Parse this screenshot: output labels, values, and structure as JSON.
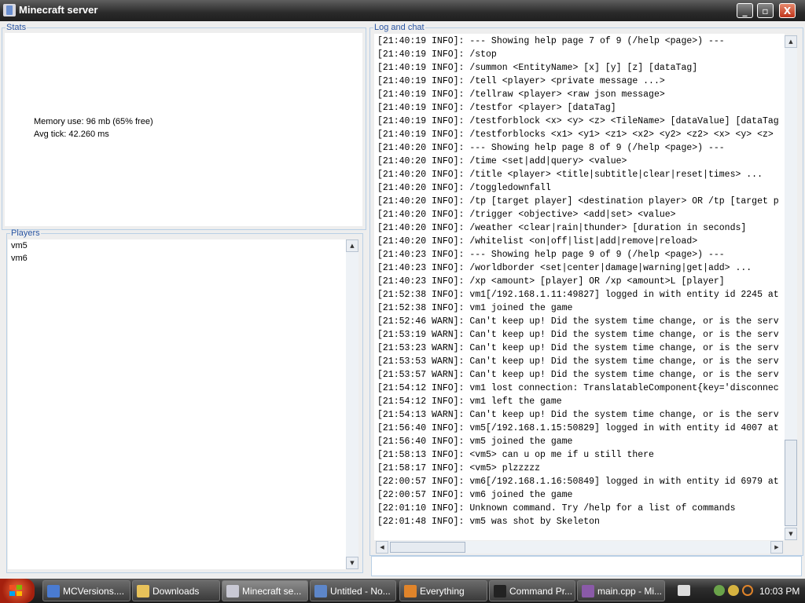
{
  "window": {
    "title": "Minecraft server",
    "buttons": {
      "minimize": "_",
      "maximize": "▫",
      "close": "X"
    }
  },
  "stats": {
    "legend": "Stats",
    "memory": "Memory use: 96 mb (65% free)",
    "avg_tick": "Avg tick: 42.260 ms"
  },
  "players": {
    "legend": "Players",
    "list": [
      "vm5",
      "vm6"
    ]
  },
  "log": {
    "legend": "Log and chat",
    "lines": [
      "[21:40:19 INFO]: --- Showing help page 7 of 9 (/help <page>) ---",
      "[21:40:19 INFO]: /stop",
      "[21:40:19 INFO]: /summon <EntityName> [x] [y] [z] [dataTag]",
      "[21:40:19 INFO]: /tell <player> <private message ...>",
      "[21:40:19 INFO]: /tellraw <player> <raw json message>",
      "[21:40:19 INFO]: /testfor <player> [dataTag]",
      "[21:40:19 INFO]: /testforblock <x> <y> <z> <TileName> [dataValue] [dataTag",
      "[21:40:19 INFO]: /testforblocks <x1> <y1> <z1> <x2> <y2> <z2> <x> <y> <z>",
      "[21:40:20 INFO]: --- Showing help page 8 of 9 (/help <page>) ---",
      "[21:40:20 INFO]: /time <set|add|query> <value>",
      "[21:40:20 INFO]: /title <player> <title|subtitle|clear|reset|times> ...",
      "[21:40:20 INFO]: /toggledownfall",
      "[21:40:20 INFO]: /tp [target player] <destination player> OR /tp [target p",
      "[21:40:20 INFO]: /trigger <objective> <add|set> <value>",
      "[21:40:20 INFO]: /weather <clear|rain|thunder> [duration in seconds]",
      "[21:40:20 INFO]: /whitelist <on|off|list|add|remove|reload>",
      "[21:40:23 INFO]: --- Showing help page 9 of 9 (/help <page>) ---",
      "[21:40:23 INFO]: /worldborder <set|center|damage|warning|get|add> ...",
      "[21:40:23 INFO]: /xp <amount> [player] OR /xp <amount>L [player]",
      "[21:52:38 INFO]: vm1[/192.168.1.11:49827] logged in with entity id 2245 at",
      "[21:52:38 INFO]: vm1 joined the game",
      "[21:52:46 WARN]: Can't keep up! Did the system time change, or is the serv",
      "[21:53:19 WARN]: Can't keep up! Did the system time change, or is the serv",
      "[21:53:23 WARN]: Can't keep up! Did the system time change, or is the serv",
      "[21:53:53 WARN]: Can't keep up! Did the system time change, or is the serv",
      "[21:53:57 WARN]: Can't keep up! Did the system time change, or is the serv",
      "[21:54:12 INFO]: vm1 lost connection: TranslatableComponent{key='disconnec",
      "[21:54:12 INFO]: vm1 left the game",
      "[21:54:13 WARN]: Can't keep up! Did the system time change, or is the serv",
      "[21:56:40 INFO]: vm5[/192.168.1.15:50829] logged in with entity id 4007 at",
      "[21:56:40 INFO]: vm5 joined the game",
      "[21:58:13 INFO]: <vm5> can u op me if u still there",
      "[21:58:17 INFO]: <vm5> plzzzzz",
      "[22:00:57 INFO]: vm6[/192.168.1.16:50849] logged in with entity id 6979 at",
      "[22:00:57 INFO]: vm6 joined the game",
      "[22:01:10 INFO]: Unknown command. Try /help for a list of commands",
      "[22:01:48 INFO]: vm5 was shot by Skeleton"
    ]
  },
  "command_input": {
    "value": ""
  },
  "taskbar": {
    "start_icon": "windows-logo-icon",
    "tasks": [
      {
        "label": "MCVersions....",
        "icon": "browser-icon",
        "color": "#4a7bd1"
      },
      {
        "label": "Downloads",
        "icon": "folder-icon",
        "color": "#e8c25a"
      },
      {
        "label": "Minecraft se...",
        "icon": "java-icon",
        "color": "#c9c9d4"
      },
      {
        "label": "Untitled - No...",
        "icon": "notepad-icon",
        "color": "#5d86c9"
      },
      {
        "label": "Everything",
        "icon": "search-icon",
        "color": "#e0842a"
      },
      {
        "label": "Command Pr...",
        "icon": "cmd-icon",
        "color": "#222222"
      },
      {
        "label": "main.cpp - Mi...",
        "icon": "visual-studio-icon",
        "color": "#8a5aa8"
      }
    ],
    "clock": "10:03 PM"
  },
  "colors": {
    "legend_text": "#2a56a3",
    "titlebar": "#2a2a2a",
    "close_button": "#c0341a",
    "start_button": "#d44a22"
  }
}
